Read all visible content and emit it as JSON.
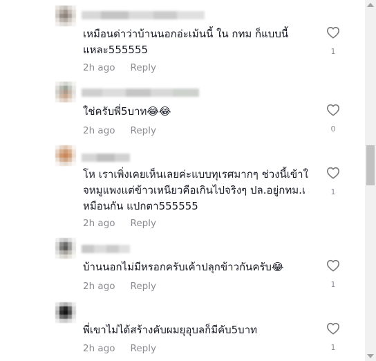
{
  "comments": [
    {
      "text": "เหมือนด่าว่าบ้านนอกอ่ะเม้นนี้ ใน กทม ก็แบบนี้\nแหละ555555",
      "time": "2h ago",
      "reply": "Reply",
      "likes": "1"
    },
    {
      "text": "ใช่ครับพี่5บาท😂😂",
      "time": "2h ago",
      "reply": "Reply",
      "likes": "0"
    },
    {
      "text": "โห เราเพิ่งเคยเห็นเลยค่ะแบบทุเรศมากๆ ช่วงนี้เข้าใจหมูแพงแต่ข้าวเหนียวคือเกินไปจริงๆ ปล.อยู่กทม.เหมือนกัน แปกตา555555",
      "time": "2h ago",
      "reply": "Reply",
      "likes": "1"
    },
    {
      "text": "บ้านนอกไม่มีหรอกครับเค้าปลุกข้าวกันครับ😂",
      "time": "2h ago",
      "reply": "Reply",
      "likes": "1"
    },
    {
      "text": "พี่เขาไม่ได้สร้างคับผมยุอุบลก็มีคับ5บาท",
      "time": "2h ago",
      "reply": "Reply",
      "likes": "1"
    }
  ],
  "icons": {
    "like": "heart-outline-icon"
  },
  "colors": {
    "text": "#161823",
    "muted": "#8a8b91",
    "heart": "#7a7a7a"
  }
}
